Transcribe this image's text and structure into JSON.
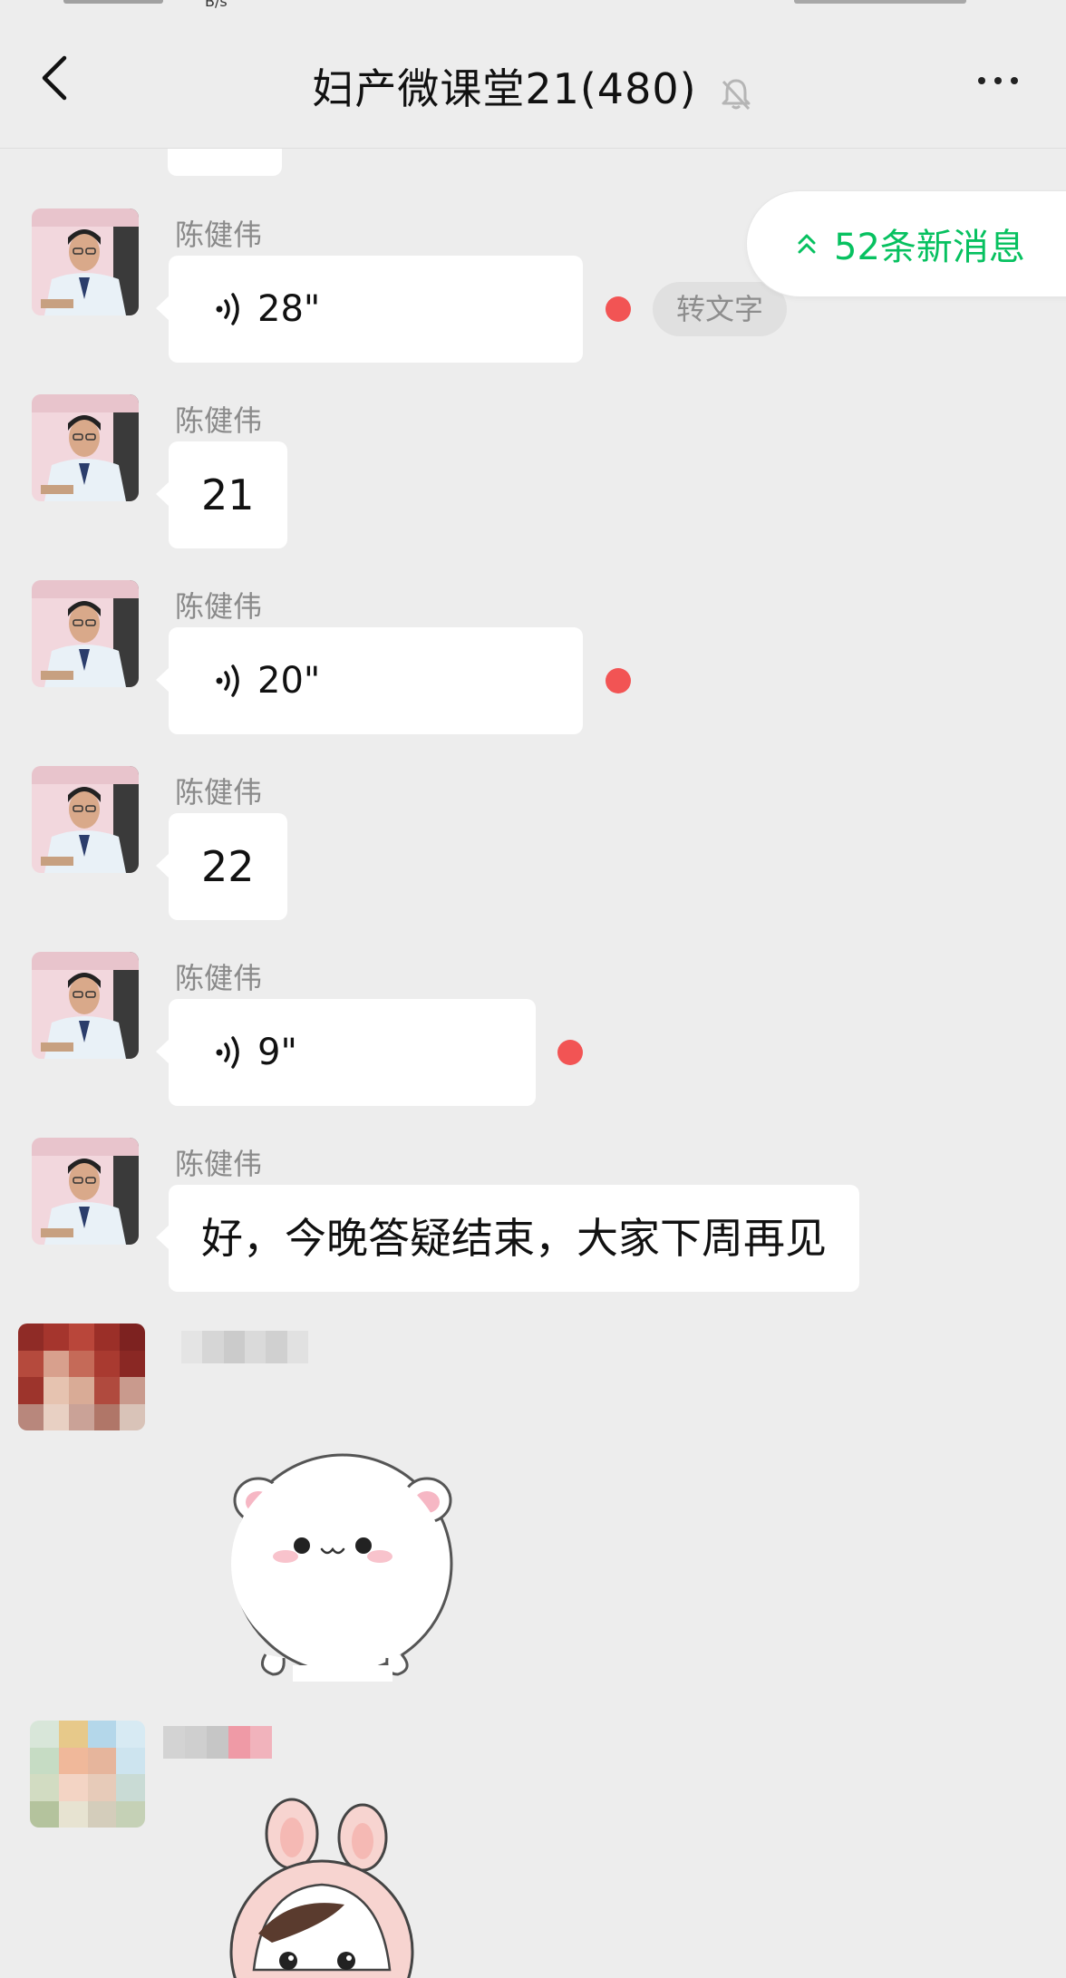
{
  "status_bar": {
    "speed_unit": "B/s"
  },
  "header": {
    "title": "妇产微课堂21(480)",
    "back_icon": "chevron-left-icon",
    "mute_icon": "bell-muted-icon",
    "more_icon": "more-dots-icon"
  },
  "new_messages": {
    "label": "52条新消息",
    "icon": "double-chevron-up-icon",
    "color": "#07c160"
  },
  "messages": [
    {
      "sender": "陈健伟",
      "type": "voice",
      "duration": "28\"",
      "unread": true,
      "to_text": "转文字"
    },
    {
      "sender": "陈健伟",
      "type": "text",
      "text": "21"
    },
    {
      "sender": "陈健伟",
      "type": "voice",
      "duration": "20\"",
      "unread": true
    },
    {
      "sender": "陈健伟",
      "type": "text",
      "text": "22"
    },
    {
      "sender": "陈健伟",
      "type": "voice",
      "duration": "9\"",
      "unread": true
    },
    {
      "sender": "陈健伟",
      "type": "text",
      "text": "好，今晚答疑结束，大家下周再见"
    },
    {
      "sender": "",
      "type": "sticker",
      "sticker": "white-bear-sticker",
      "masked_sender": true
    },
    {
      "sender": "",
      "type": "sticker",
      "sticker": "pink-bunny-girl-sticker",
      "masked_sender": true
    }
  ],
  "colors": {
    "background": "#ededed",
    "bubble": "#ffffff",
    "unread_dot": "#f25454",
    "accent": "#07c160"
  }
}
